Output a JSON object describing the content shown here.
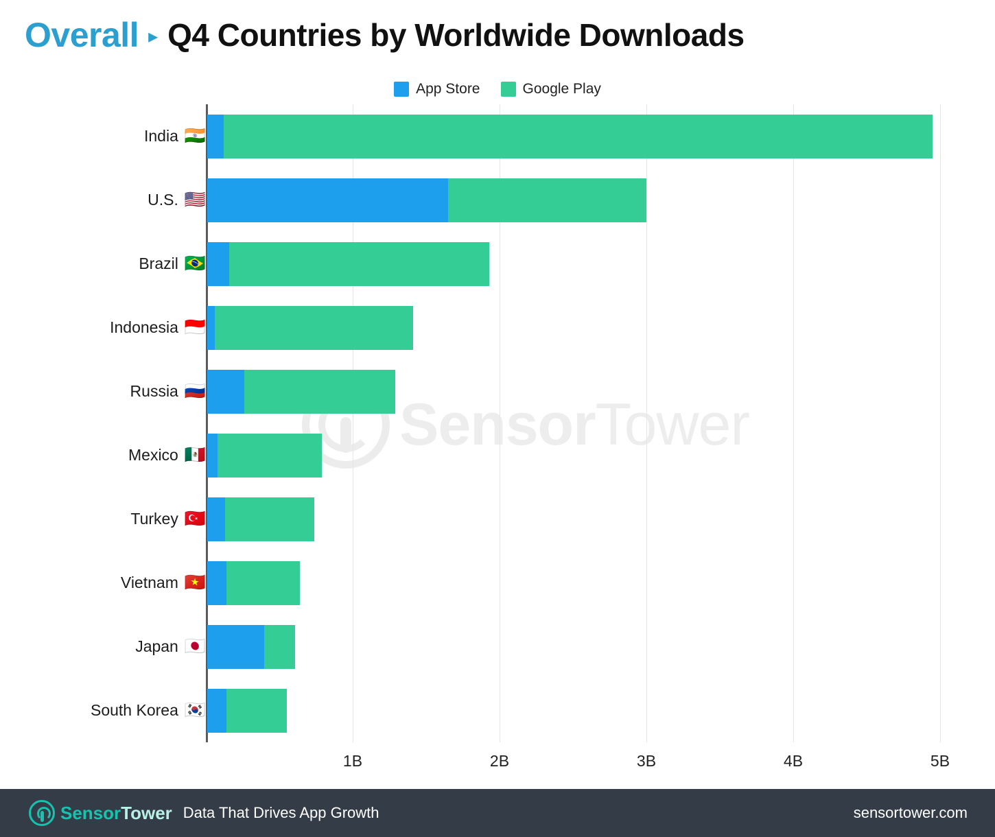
{
  "header": {
    "category": "Overall",
    "separator_icon": "triangle-right-icon",
    "title": "Q4 Countries by Worldwide Downloads"
  },
  "legend": {
    "position": "top-center",
    "items": [
      {
        "label": "App Store",
        "color": "#1e9fee",
        "icon": "legend-swatch"
      },
      {
        "label": "Google Play",
        "color": "#35cd96",
        "icon": "legend-swatch"
      }
    ]
  },
  "watermark": {
    "brand_bold": "Sensor",
    "brand_light": "Tower",
    "icon": "sensortower-logo-icon"
  },
  "footer": {
    "logo_icon": "sensortower-logo-icon",
    "logo_bold": "Sensor",
    "logo_light": "Tower",
    "tagline": "Data That Drives App Growth",
    "url": "sensortower.com"
  },
  "chart_data": {
    "type": "bar",
    "orientation": "horizontal",
    "stacked": true,
    "title": "Q4 Countries by Worldwide Downloads",
    "subtitle": "Overall",
    "xlabel": "",
    "ylabel": "",
    "xlim": [
      0,
      5.1
    ],
    "unit": "Downloads (billions)",
    "grid": true,
    "tick_labels": [
      "1B",
      "2B",
      "3B",
      "4B",
      "5B"
    ],
    "tick_values": [
      1,
      2,
      3,
      4,
      5
    ],
    "legend_position": "top-center",
    "categories": [
      "India",
      "U.S.",
      "Brazil",
      "Indonesia",
      "Russia",
      "Mexico",
      "Turkey",
      "Vietnam",
      "Japan",
      "South Korea"
    ],
    "flags": [
      "🇮🇳",
      "🇺🇸",
      "🇧🇷",
      "🇮🇩",
      "🇷🇺",
      "🇲🇽",
      "🇹🇷",
      "🇻🇳",
      "🇯🇵",
      "🇰🇷"
    ],
    "series": [
      {
        "name": "App Store",
        "color": "#1e9fee",
        "values": [
          0.11,
          1.64,
          0.15,
          0.05,
          0.25,
          0.07,
          0.12,
          0.13,
          0.39,
          0.13
        ]
      },
      {
        "name": "Google Play",
        "color": "#35cd96",
        "values": [
          4.83,
          1.35,
          1.77,
          1.35,
          1.03,
          0.71,
          0.61,
          0.5,
          0.21,
          0.41
        ]
      }
    ],
    "totals": [
      4.94,
      2.99,
      1.92,
      1.4,
      1.28,
      0.78,
      0.73,
      0.63,
      0.6,
      0.54
    ]
  }
}
